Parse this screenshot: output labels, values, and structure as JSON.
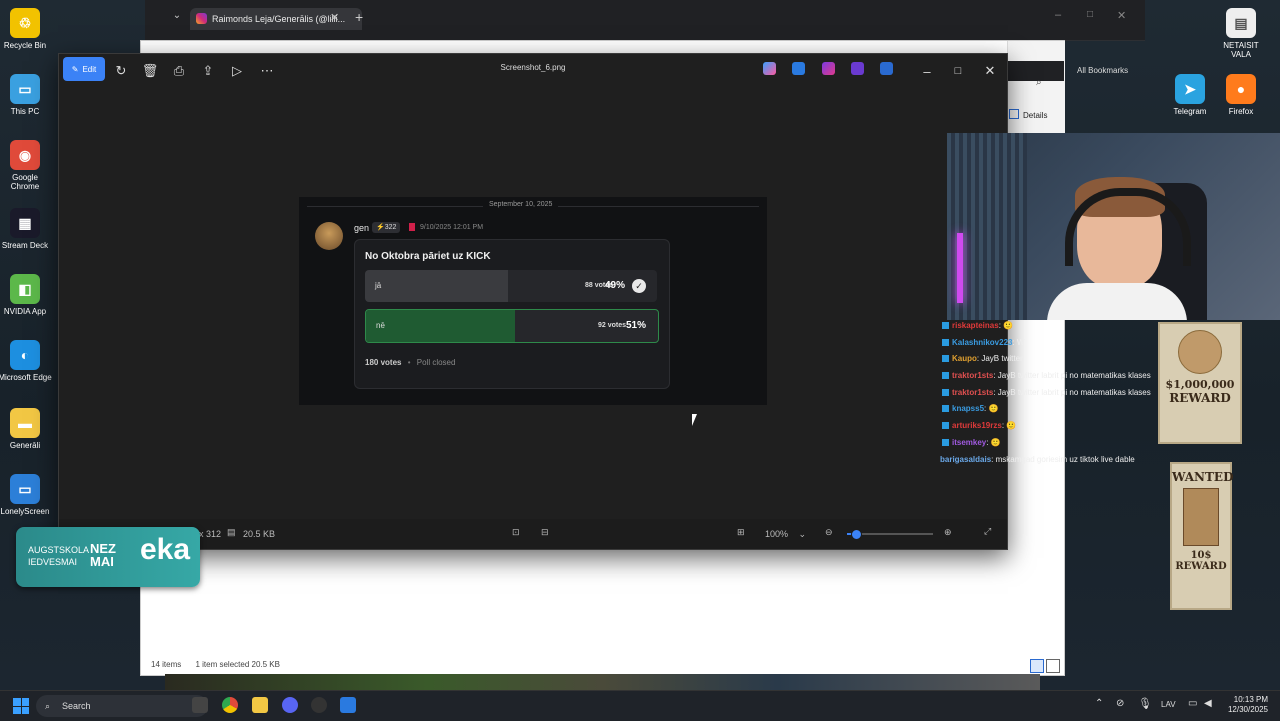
{
  "desktop": {
    "icons_left": [
      {
        "label": "Recycle Bin",
        "glyph": "♲",
        "color": "#f2c200"
      },
      {
        "label": "This PC",
        "glyph": "▭",
        "color": "#3aa0e0"
      },
      {
        "label": "Google Chrome",
        "glyph": "◉",
        "color": "#e04a3a"
      },
      {
        "label": "Stream Deck",
        "glyph": "▦",
        "color": "#1a1a2a"
      },
      {
        "label": "NVIDIA App",
        "glyph": "◧",
        "color": "#5cb84a"
      },
      {
        "label": "Microsoft Edge",
        "glyph": "◐",
        "color": "#1d8fe0"
      },
      {
        "label": "Generāli",
        "glyph": "▬",
        "color": "#f2c744"
      },
      {
        "label": "LonelyScreen",
        "glyph": "▭",
        "color": "#2c7fd8"
      }
    ],
    "icons_right": [
      {
        "label": "NETAISIT VALA",
        "glyph": "▤",
        "color": "#eeeeee"
      },
      {
        "label": "Telegram",
        "glyph": "➤",
        "color": "#2aa3e0"
      },
      {
        "label": "Firefox",
        "glyph": "●",
        "color": "#ff7b1c"
      }
    ],
    "overlay_logo": {
      "left": "AUGSTSKOLA\nIEDVESMAI",
      "mid": "NEZ\nMAI",
      "right": "eka"
    }
  },
  "browser": {
    "tab_title": "Raimonds Leja/Generālis (@lilli...",
    "bookmarks_label": "All Bookmarks",
    "details_label": "Details"
  },
  "explorer": {
    "items_count": "14 items",
    "selected": "1 item selected  20.5 KB"
  },
  "photos": {
    "edit_label": "Edit",
    "title": "Screenshot_6.png",
    "dims": "x 312",
    "size": "20.5 KB",
    "zoom": "100%",
    "zoom_level_fraction": 0.1
  },
  "shot": {
    "date": "September 10, 2025",
    "user": "gen",
    "badge": "322",
    "timestamp": "9/10/2025 12:01 PM",
    "question": "No Oktobra pāriet uz KICK",
    "options": [
      {
        "label": "jā",
        "votes": "88 votes",
        "pct": "49%",
        "fraction": 0.49,
        "checked": true,
        "fill": "#3a3b3f"
      },
      {
        "label": "nē",
        "votes": "92 votes",
        "pct": "51%",
        "fraction": 0.51,
        "checked": false,
        "fill": "#1f5b32"
      }
    ],
    "total": "180 votes",
    "status": "Poll closed"
  },
  "chat": [
    {
      "user": "riskapteinas",
      "msg": ": 🙂",
      "color": "#e03a3a"
    },
    {
      "user": "Kalashnikov223",
      "msg": ": W",
      "color": "#3a9be0"
    },
    {
      "user": "Kaupo",
      "msg": ": JayB twitter",
      "color": "#e0a030"
    },
    {
      "user": "traktor1sts",
      "msg": ": JayB twitter labrit pi no matematikas klases",
      "color": "#e05050"
    },
    {
      "user": "traktor1sts",
      "msg": ": JayB twitter labrit pi no matematikas klases",
      "color": "#e05050"
    },
    {
      "user": "knapss5",
      "msg": ": 🙂",
      "color": "#3a9be0"
    },
    {
      "user": "arturiks19rzs",
      "msg": ": 🙂",
      "color": "#e03a3a"
    },
    {
      "user": "itsemkey",
      "msg": ": 🙂",
      "color": "#a05ae0"
    },
    {
      "user": "barigasaldais",
      "msg": ": mskamgad goriesim uz tiktok live dable",
      "color": "#6aa8e8"
    }
  ],
  "posters": {
    "top_amount": "$1,000,000",
    "top_reward": "REWARD",
    "wanted": "WANTED",
    "bottom_amount": "10$",
    "bottom_reward": "REWARD"
  },
  "taskbar": {
    "search_placeholder": "Search",
    "lang": "LAV",
    "time": "10:13 PM",
    "date": "12/30/2025"
  }
}
